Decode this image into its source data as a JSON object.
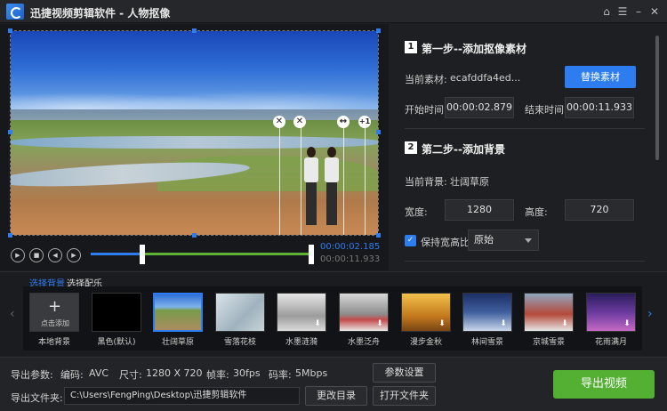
{
  "window": {
    "title": "迅捷视频剪辑软件 - 人物抠像"
  },
  "titlebar": {
    "home_icon": "⌂",
    "menu_icon": "☰",
    "min_icon": "–",
    "close_icon": "✕"
  },
  "player": {
    "current_time": "00:00:02.185",
    "total_time": "00:00:11.933",
    "progress_fraction": 0.18,
    "person_ctrl_close": "✕",
    "person_ctrl_flip": "↔",
    "person_ctrl_add": "+1"
  },
  "step1": {
    "num": "1",
    "title": "第一步--添加抠像素材",
    "current_label": "当前素材:",
    "current_value": "ecafddfa4ed...",
    "replace_button": "替换素材",
    "start_label": "开始时间",
    "start_value": "00:00:02.879",
    "end_label": "结束时间",
    "end_value": "00:00:11.933"
  },
  "step2": {
    "num": "2",
    "title": "第二步--添加背景",
    "current_bg_label": "当前背景:",
    "current_bg_value": "壮阔草原",
    "width_label": "宽度:",
    "width_value": "1280",
    "height_label": "高度:",
    "height_value": "720",
    "keep_ratio_label": "保持宽高比",
    "keep_ratio_checked": true,
    "ratio_option": "原始"
  },
  "tabs": {
    "background": "选择背景",
    "music": "选择配乐"
  },
  "backgrounds": [
    {
      "label": "本地背景",
      "sub": "点击添加"
    },
    {
      "label": "黑色(默认)"
    },
    {
      "label": "壮阔草原"
    },
    {
      "label": "雪落花枝"
    },
    {
      "label": "水墨涟漪"
    },
    {
      "label": "水墨泛舟"
    },
    {
      "label": "漫步金秋"
    },
    {
      "label": "林间雪景"
    },
    {
      "label": "京城雪景"
    },
    {
      "label": "花雨满月"
    }
  ],
  "export": {
    "params_label": "导出参数:",
    "codec_label": "编码:",
    "codec_value": "AVC",
    "size_label": "尺寸:",
    "size_value": "1280 X 720",
    "fps_label": "帧率:",
    "fps_value": "30fps",
    "bitrate_label": "码率:",
    "bitrate_value": "5Mbps",
    "settings_button": "参数设置",
    "folder_label": "导出文件夹:",
    "folder_path": "C:\\Users\\FengPing\\Desktop\\迅捷剪辑软件",
    "change_dir_button": "更改目录",
    "open_folder_button": "打开文件夹",
    "export_button": "导出视频"
  },
  "colors": {
    "accent": "#2d7cf0",
    "export_green": "#53b033",
    "progress_green": "#5db336"
  }
}
